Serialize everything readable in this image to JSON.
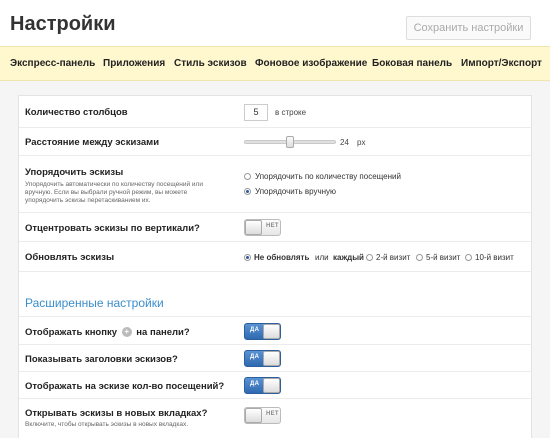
{
  "header": {
    "title": "Настройки",
    "save_label": "Сохранить настройки"
  },
  "tabs": [
    {
      "label": "Экспресс-панель"
    },
    {
      "label": "Приложения"
    },
    {
      "label": "Стиль эскизов"
    },
    {
      "label": "Фоновое изображение"
    },
    {
      "label": "Боковая панель"
    },
    {
      "label": "Импорт/Экспорт"
    }
  ],
  "settings": {
    "columns": {
      "label": "Количество столбцов",
      "value": "5",
      "suffix": "в строке"
    },
    "spacing": {
      "label": "Расстояние между эскизами",
      "value": "24",
      "unit": "px",
      "slider_level": 0.5
    },
    "sort": {
      "label": "Упорядочить эскизы",
      "description": "Упорядочить автоматически по количеству посещений или вручную. Если вы выбрали ручной режим, вы можете упорядочить эскизы перетаскиванием их.",
      "options": [
        {
          "label": "Упорядочить по количеству посещений",
          "selected": false
        },
        {
          "label": "Упорядочить вручную",
          "selected": true
        }
      ]
    },
    "center": {
      "label": "Отцентровать эскизы по вертикали?",
      "toggle": "НЕТ",
      "on": false
    },
    "refresh": {
      "label": "Обновлять эскизы",
      "options": [
        {
          "label": "Не обновлять",
          "selected": true
        },
        {
          "label": "или",
          "selected": false
        },
        {
          "label": "каждый",
          "selected": false
        },
        {
          "label": "2-й визит",
          "selected": false
        },
        {
          "label": "5-й визит",
          "selected": false
        },
        {
          "label": "10-й визит",
          "selected": false
        }
      ]
    }
  },
  "advanced": {
    "title": "Расширенные настройки",
    "show_button": {
      "label_before": "Отображать кнопку",
      "label_after": "на панели?",
      "toggle": "ДА",
      "on": true
    },
    "show_titles": {
      "label": "Показывать заголовки эскизов?",
      "toggle": "ДА",
      "on": true
    },
    "show_visits": {
      "label": "Отображать на эскизе кол-во посещений?",
      "toggle": "ДА",
      "on": true
    },
    "new_tabs": {
      "label": "Открывать эскизы в новых вкладках?",
      "description": "Включите, чтобы открывать эскизы в новых вкладках.",
      "toggle": "НЕТ",
      "on": false
    }
  },
  "colors": {
    "accent": "#3b8ecb",
    "tab_bar": "#fff8cf",
    "toggle_on": "#3a78c0"
  }
}
